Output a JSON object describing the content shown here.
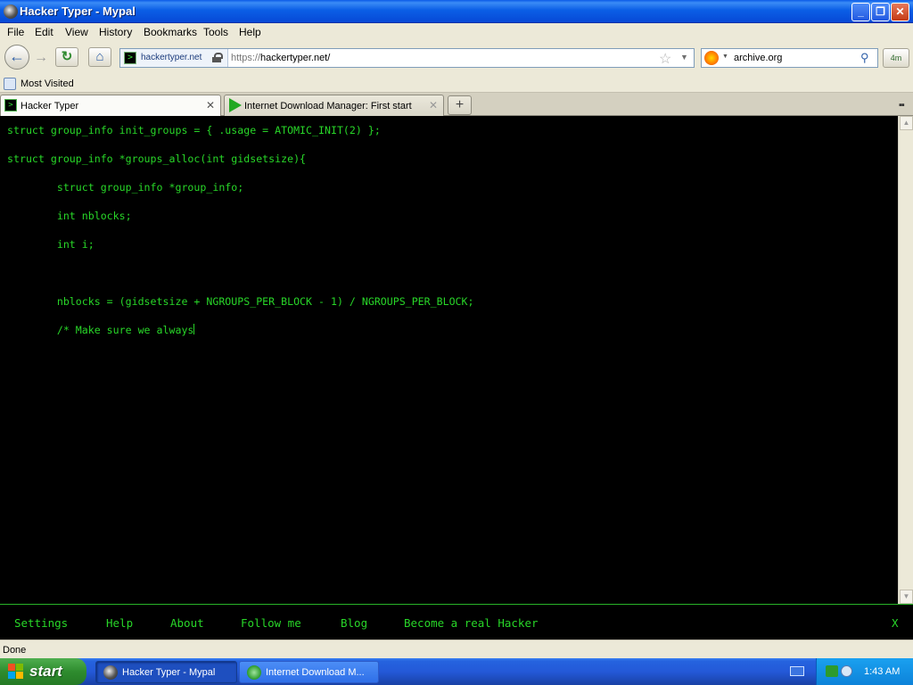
{
  "window": {
    "title": "Hacker Typer - Mypal"
  },
  "menu": [
    "File",
    "Edit",
    "View",
    "History",
    "Bookmarks",
    "Tools",
    "Help"
  ],
  "nav": {
    "site_identity": "hackertyper.net",
    "url_scheme": "https://",
    "url_host": "hackertyper.net/",
    "search_value": "archive.org",
    "addon_label": "4m"
  },
  "bookmarks": {
    "most_visited": "Most Visited"
  },
  "tabs": [
    {
      "label": "Hacker Typer",
      "active": true
    },
    {
      "label": "Internet Download Manager: First start",
      "active": false
    }
  ],
  "code_lines": [
    "struct group_info init_groups = { .usage = ATOMIC_INIT(2) };",
    "",
    "struct group_info *groups_alloc(int gidsetsize){",
    "",
    "        struct group_info *group_info;",
    "",
    "        int nblocks;",
    "",
    "        int i;",
    "",
    "",
    "",
    "        nblocks = (gidsetsize + NGROUPS_PER_BLOCK - 1) / NGROUPS_PER_BLOCK;",
    "",
    "        /* Make sure we always"
  ],
  "footer": {
    "settings": "Settings",
    "help": "Help",
    "about": "About",
    "follow": "Follow me",
    "blog": "Blog",
    "hacker": "Become a real Hacker",
    "close": "X"
  },
  "status": {
    "text": "Done"
  },
  "taskbar": {
    "start": "start",
    "tasks": [
      "Hacker Typer - Mypal",
      "Internet Download M..."
    ],
    "clock": "1:43 AM"
  },
  "colors": {
    "terminal_green": "#28d628",
    "background": "#000000"
  }
}
